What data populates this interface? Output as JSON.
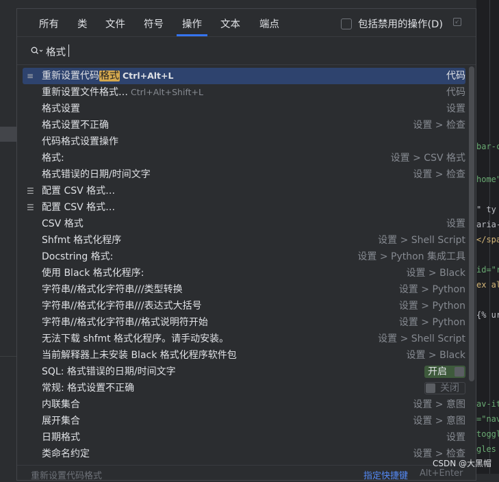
{
  "tabs": [
    "所有",
    "类",
    "文件",
    "符号",
    "操作",
    "文本",
    "端点"
  ],
  "active_tab": "操作",
  "include_disabled": {
    "label": "包括禁用的操作(D)",
    "checked": false
  },
  "search": {
    "value": "格式"
  },
  "results": [
    {
      "icon": "list-format-icon",
      "pre": "重新设置代码",
      "hl": "格式",
      "post": "",
      "shortcut": "Ctrl+Alt+L",
      "location": "代码",
      "selected": true
    },
    {
      "icon": "",
      "pre": "重新设置文件格式…",
      "hl": "",
      "post": "",
      "shortcut": "Ctrl+Alt+Shift+L",
      "location": "代码"
    },
    {
      "icon": "",
      "pre": "格式设置",
      "hl": "",
      "post": "",
      "shortcut": "",
      "location": "设置"
    },
    {
      "icon": "",
      "pre": "格式设置不正确",
      "hl": "",
      "post": "",
      "shortcut": "",
      "location": "设置 > 检查"
    },
    {
      "icon": "",
      "pre": "代码格式设置操作",
      "hl": "",
      "post": "",
      "shortcut": "",
      "location": ""
    },
    {
      "icon": "",
      "pre": "格式:",
      "hl": "",
      "post": "",
      "shortcut": "",
      "location": "设置 > CSV 格式"
    },
    {
      "icon": "",
      "pre": "格式错误的日期/时间文字",
      "hl": "",
      "post": "",
      "shortcut": "",
      "location": "设置 > 检查"
    },
    {
      "icon": "sliders-icon",
      "pre": "配置 CSV 格式…",
      "hl": "",
      "post": "",
      "shortcut": "",
      "location": ""
    },
    {
      "icon": "sliders-icon",
      "pre": "配置 CSV 格式…",
      "hl": "",
      "post": "",
      "shortcut": "",
      "location": ""
    },
    {
      "icon": "",
      "pre": "CSV 格式",
      "hl": "",
      "post": "",
      "shortcut": "",
      "location": "设置"
    },
    {
      "icon": "",
      "pre": "Shfmt 格式化程序",
      "hl": "",
      "post": "",
      "shortcut": "",
      "location": "设置 > Shell Script"
    },
    {
      "icon": "",
      "pre": "Docstring 格式:",
      "hl": "",
      "post": "",
      "shortcut": "",
      "location": "设置 > Python 集成工具"
    },
    {
      "icon": "",
      "pre": "使用 Black 格式化程序:",
      "hl": "",
      "post": "",
      "shortcut": "",
      "location": "设置 > Black"
    },
    {
      "icon": "",
      "pre": "字符串//格式化字符串///类型转换",
      "hl": "",
      "post": "",
      "shortcut": "",
      "location": "设置 > Python"
    },
    {
      "icon": "",
      "pre": "字符串//格式化字符串///表达式大括号",
      "hl": "",
      "post": "",
      "shortcut": "",
      "location": "设置 > Python"
    },
    {
      "icon": "",
      "pre": "字符串//格式化字符串//格式说明符开始",
      "hl": "",
      "post": "",
      "shortcut": "",
      "location": "设置 > Python"
    },
    {
      "icon": "",
      "pre": "无法下载 shfmt 格式化程序。请手动安装。",
      "hl": "",
      "post": "",
      "shortcut": "",
      "location": "设置 > Shell Script"
    },
    {
      "icon": "",
      "pre": "当前解释器上未安装 Black 格式化程序软件包",
      "hl": "",
      "post": "",
      "shortcut": "",
      "location": "设置 > Black"
    },
    {
      "icon": "",
      "pre": "SQL: 格式错误的日期/时间文字",
      "hl": "",
      "post": "",
      "shortcut": "",
      "location": "",
      "toggle": "开启"
    },
    {
      "icon": "",
      "pre": "常规: 格式设置不正确",
      "hl": "",
      "post": "",
      "shortcut": "",
      "location": "",
      "toggle": "关闭"
    },
    {
      "icon": "",
      "pre": "内联集合",
      "hl": "",
      "post": "",
      "shortcut": "",
      "location": "设置 > 意图"
    },
    {
      "icon": "",
      "pre": "展开集合",
      "hl": "",
      "post": "",
      "shortcut": "",
      "location": "设置 > 意图"
    },
    {
      "icon": "",
      "pre": "日期格式",
      "hl": "",
      "post": "",
      "shortcut": "",
      "location": "设置"
    },
    {
      "icon": "",
      "pre": "类命名约定",
      "hl": "",
      "post": "",
      "shortcut": "",
      "location": "设置 > 检查"
    }
  ],
  "footer": {
    "hint": "重新设置代码格式",
    "assign": "指定快捷键",
    "keys": "Alt+Enter"
  },
  "watermark": "CSDN @大黑帽",
  "colors": {
    "accent": "#3574f0",
    "selection": "#2e436e",
    "highlight": "#d4a84e",
    "toggle_on": "#3e5a3c"
  },
  "background_code": [
    {
      "text": "bar-c",
      "color": "#6aab73"
    },
    {
      "text": "home\"",
      "color": "#6aab73"
    },
    {
      "text": "\" ty",
      "color": "#bcbec4"
    },
    {
      "text": "aria-",
      "color": "#bcbec4"
    },
    {
      "text": "</spa",
      "color": "#d5b778"
    },
    {
      "text": "id=\"r",
      "color": "#6aab73"
    },
    {
      "text": "ex al",
      "color": "#d5b778"
    },
    {
      "text": "{% ur",
      "color": "#bcbec4"
    },
    {
      "text": "av-it",
      "color": "#6aab73"
    },
    {
      "text": "=\"nav",
      "color": "#6aab73"
    },
    {
      "text": "toggl",
      "color": "#6aab73"
    },
    {
      "text": "gles",
      "color": "#6aab73"
    }
  ]
}
